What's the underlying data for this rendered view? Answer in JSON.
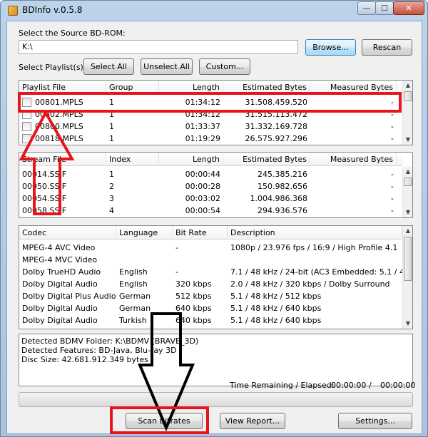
{
  "window": {
    "title": "BDInfo v.0.5.8",
    "min_glyph": "—",
    "max_glyph": "☐",
    "close_glyph": "✕"
  },
  "source": {
    "label": "Select the Source BD-ROM:",
    "path": "K:\\",
    "browse_label": "Browse...",
    "rescan_label": "Rescan"
  },
  "playlist_select": {
    "label": "Select Playlist(s):",
    "select_all": "Select All",
    "unselect_all": "Unselect All",
    "custom": "Custom..."
  },
  "playlists": {
    "headers": [
      "Playlist File",
      "Group",
      "Length",
      "Estimated Bytes",
      "Measured Bytes"
    ],
    "rows": [
      {
        "file": "00801.MPLS",
        "group": "1",
        "length": "01:34:12",
        "est": "31.508.459.520",
        "meas": "-"
      },
      {
        "file": "00802.MPLS",
        "group": "1",
        "length": "01:34:12",
        "est": "31.515.113.472",
        "meas": "-"
      },
      {
        "file": "00800.MPLS",
        "group": "1",
        "length": "01:33:37",
        "est": "31.332.169.728",
        "meas": "-"
      },
      {
        "file": "00818.MPLS",
        "group": "1",
        "length": "01:19:29",
        "est": "26.575.927.296",
        "meas": "-"
      }
    ]
  },
  "streams": {
    "headers": [
      "Stream File",
      "Index",
      "Length",
      "Estimated Bytes",
      "Measured Bytes"
    ],
    "rows": [
      {
        "file": "00014.SSIF",
        "index": "1",
        "length": "00:00:44",
        "est": "245.385.216",
        "meas": "-"
      },
      {
        "file": "00050.SSIF",
        "index": "2",
        "length": "00:00:28",
        "est": "150.982.656",
        "meas": "-"
      },
      {
        "file": "00054.SSIF",
        "index": "3",
        "length": "00:03:02",
        "est": "1.004.986.368",
        "meas": "-"
      },
      {
        "file": "00058.SSIF",
        "index": "4",
        "length": "00:00:54",
        "est": "294.936.576",
        "meas": "-"
      }
    ]
  },
  "codecs": {
    "headers": [
      "Codec",
      "Language",
      "Bit Rate",
      "Description"
    ],
    "rows": [
      {
        "codec": "MPEG-4 AVC Video",
        "lang": "",
        "rate": "-",
        "desc": "1080p / 23.976 fps / 16:9 / High Profile 4.1"
      },
      {
        "codec": "MPEG-4 MVC Video",
        "lang": "",
        "rate": "",
        "desc": ""
      },
      {
        "codec": "Dolby TrueHD Audio",
        "lang": "English",
        "rate": "-",
        "desc": "7.1 / 48 kHz / 24-bit (AC3 Embedded: 5.1 / 4..."
      },
      {
        "codec": "Dolby Digital Audio",
        "lang": "English",
        "rate": "320 kbps",
        "desc": "2.0 / 48 kHz / 320 kbps / Dolby Surround"
      },
      {
        "codec": "Dolby Digital Plus Audio",
        "lang": "German",
        "rate": "512 kbps",
        "desc": "5.1 / 48 kHz / 512 kbps"
      },
      {
        "codec": "Dolby Digital Audio",
        "lang": "German",
        "rate": "640 kbps",
        "desc": "5.1 / 48 kHz / 640 kbps"
      },
      {
        "codec": "Dolby Digital Audio",
        "lang": "Turkish",
        "rate": "640 kbps",
        "desc": "5.1 / 48 kHz / 640 kbps"
      }
    ]
  },
  "info": {
    "lines": [
      "Detected BDMV Folder: K:\\BDMV (BRAVE_3D)",
      "Detected Features: BD-Java, Blu-ray 3D",
      "Disc Size: 42.681.912.349 bytes"
    ]
  },
  "timer": {
    "label": "Time Remaining / Elapsed:",
    "remaining": "00:00:00",
    "sep": "/",
    "elapsed": "00:00:00"
  },
  "progress": {
    "fraction": 0
  },
  "actions": {
    "scan": "Scan Bitrates",
    "report": "View Report...",
    "settings": "Settings..."
  },
  "colors": {
    "annotation": "#e8141b"
  }
}
